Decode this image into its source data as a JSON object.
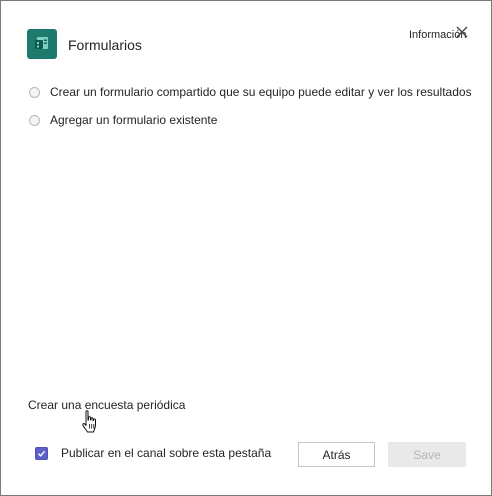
{
  "header": {
    "app_icon": "forms-app-icon",
    "title": "Formularios",
    "info_label": "Información",
    "close_icon": "close-icon"
  },
  "options": [
    {
      "label": "Crear un formulario compartido que su equipo puede editar y ver los resultados",
      "selected": false
    },
    {
      "label": "Agregar un formulario existente",
      "selected": false
    }
  ],
  "survey_link": "Crear una encuesta periódica",
  "publish": {
    "label": "Publicar en el canal sobre esta pestaña",
    "checked": true
  },
  "buttons": {
    "back_label": "Atrás",
    "save_label": "Save"
  },
  "colors": {
    "app_icon_bg": "#1f7a6e",
    "checkbox_accent": "#5b5fc7",
    "save_disabled_bg": "#e9e9e9"
  }
}
